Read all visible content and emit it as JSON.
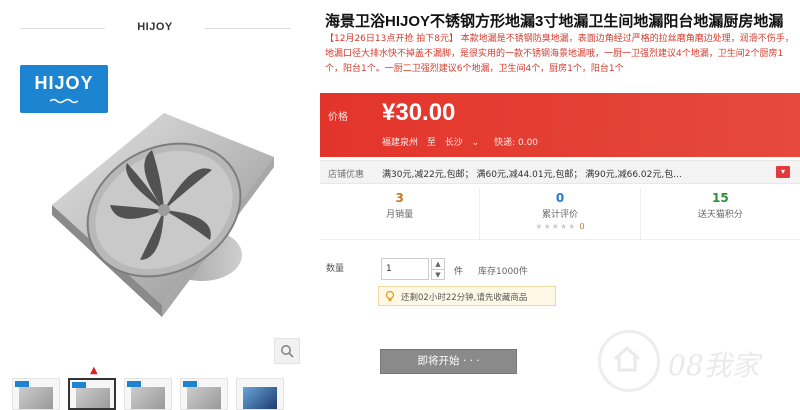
{
  "brand_header": "HIJOY",
  "logo_text": "HIJOY",
  "product": {
    "title": "海景卫浴HIJOY不锈钢方形地漏3寸地漏卫生间地漏阳台地漏厨房地漏",
    "description": "【12月26日13点开抢 拍下8元】 本款地漏是不锈钢防臭地漏，表面边角经过严格的拉丝磨角磨边处理，润滑不伤手，地漏口径大排水快不掉盖不漏脚，是很实用的一款不锈钢海景地漏哦，一厨一卫强烈建议4个地漏，卫生间2个厨房1个，阳台1个。一厨二卫强烈建议6个地漏，卫生间4个，厨房1个，阳台1个"
  },
  "price": {
    "label": "价格",
    "value": "¥30.00",
    "origin": "福建泉州",
    "to": "至",
    "dest": "长沙",
    "shipping": "快递: 0.00"
  },
  "promo": {
    "label": "店铺优惠",
    "text": "满30元,减22元,包邮； 满60元,减44.01元,包邮； 满90元,减66.02元,包...",
    "more": "▾"
  },
  "stats": [
    {
      "num": "3",
      "label": "月销量"
    },
    {
      "num": "0",
      "label": "累计评价",
      "stars": "★★★★★",
      "stars_count": "0"
    },
    {
      "num": "15",
      "label": "送天猫积分"
    }
  ],
  "quantity": {
    "label": "数量",
    "value": "1",
    "unit": "件",
    "stock": "库存1000件"
  },
  "countdown": "还剩02小时22分钟,请先收藏商品",
  "buy_button": "即将开始 · · ·",
  "watermark": "08我家",
  "colors": {
    "price_red": "#e3342b",
    "logo_blue": "#1d84d1"
  }
}
